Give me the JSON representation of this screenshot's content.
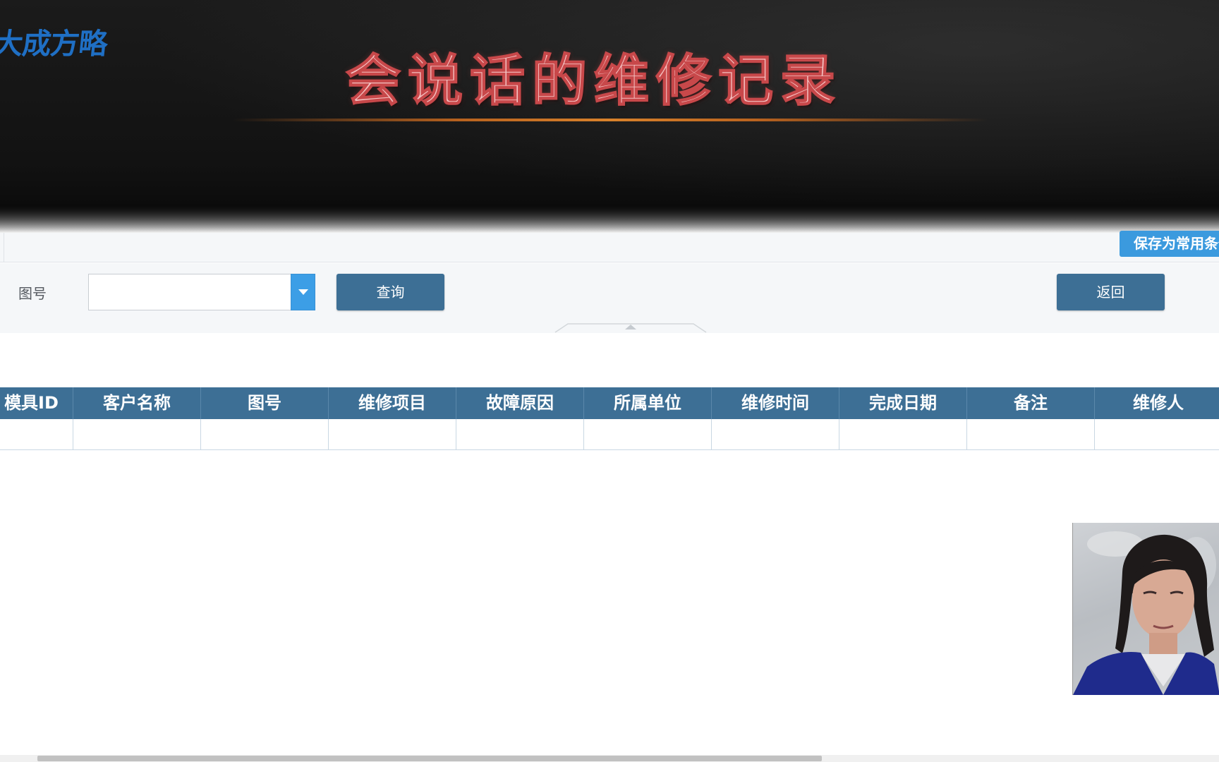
{
  "banner": {
    "logo": "大成方略",
    "title": "会说话的维修记录"
  },
  "toolbar": {
    "save_label": "保存为常用条件"
  },
  "filter": {
    "label": "图号",
    "input_value": "",
    "query_label": "查询",
    "back_label": "返回"
  },
  "table": {
    "columns": [
      "模具ID",
      "客户名称",
      "图号",
      "维修项目",
      "故障原因",
      "所属单位",
      "维修时间",
      "完成日期",
      "备注",
      "维修人"
    ],
    "rows": [
      [
        "",
        "",
        "",
        "",
        "",
        "",
        "",
        "",
        "",
        ""
      ]
    ]
  },
  "colors": {
    "header_bg": "#3d6f95",
    "button_bg": "#3d6f95",
    "accent_blue": "#3b9ade",
    "title_fill": "#f4c2c2",
    "title_stroke": "#c8484a"
  },
  "icons": {
    "dropdown": "caret-down-icon",
    "collapse": "collapse-up-icon"
  }
}
